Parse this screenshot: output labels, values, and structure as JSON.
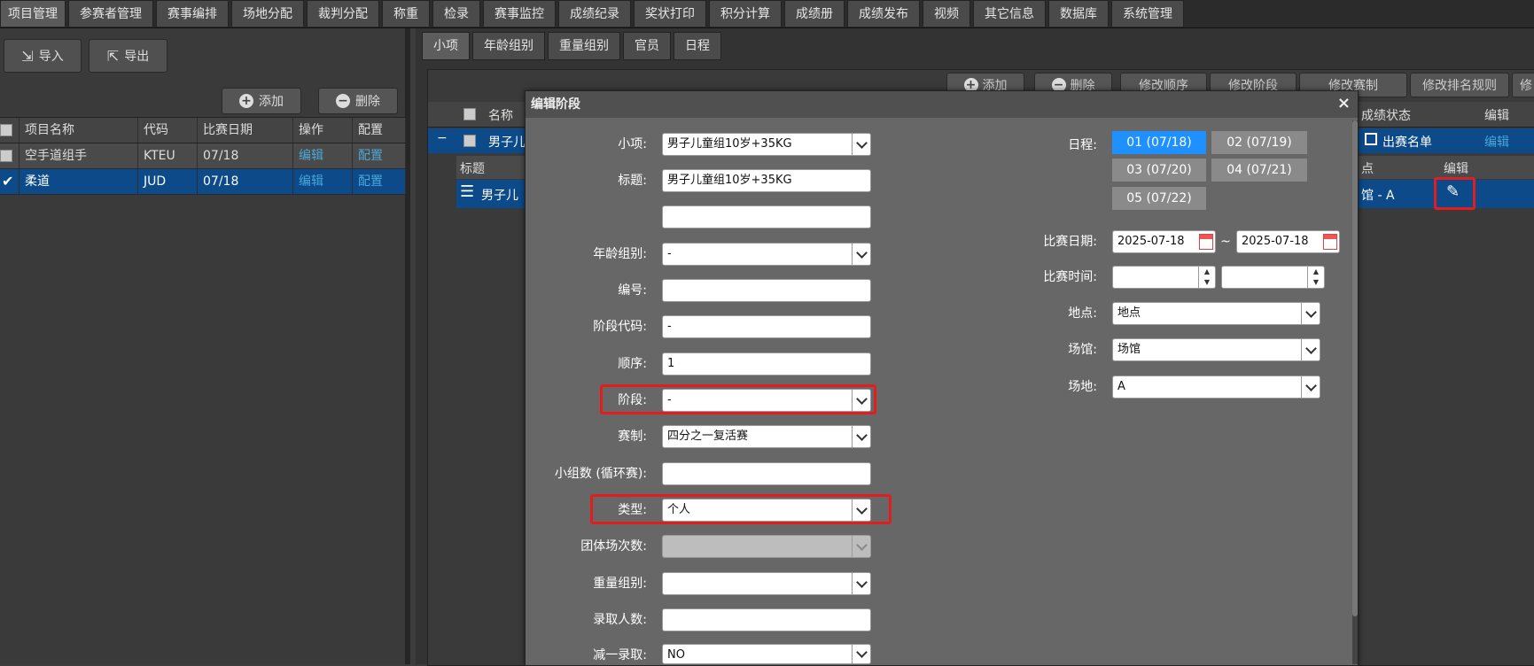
{
  "top_nav": [
    "项目管理",
    "参赛者管理",
    "赛事编排",
    "场地分配",
    "裁判分配",
    "称重",
    "检录",
    "赛事监控",
    "成绩纪录",
    "奖状打印",
    "积分计算",
    "成绩册",
    "成绩发布",
    "视频",
    "其它信息",
    "数据库",
    "系统管理"
  ],
  "left": {
    "import_label": "导入",
    "export_label": "导出",
    "add_label": "添加",
    "delete_label": "删除",
    "columns": [
      "项目名称",
      "代码",
      "比赛日期",
      "操作",
      "配置"
    ],
    "rows": [
      {
        "name": "空手道组手",
        "code": "KTEU",
        "date": "07/18",
        "op": "编辑",
        "cfg": "配置",
        "checked": false,
        "selected": false
      },
      {
        "name": "柔道",
        "code": "JUD",
        "date": "07/18",
        "op": "编辑",
        "cfg": "配置",
        "checked": true,
        "selected": true
      }
    ]
  },
  "right": {
    "subtabs": [
      "小项",
      "年龄组别",
      "重量组别",
      "官员",
      "日程"
    ],
    "toolbar": [
      "添加",
      "删除",
      "修改顺序",
      "修改阶段",
      "修改赛制",
      "修改排名规则",
      "修"
    ],
    "head": {
      "name": "名称",
      "status": "成绩状态",
      "edit": "编辑"
    },
    "row": {
      "minus": "−",
      "name": "男子儿",
      "status": "出赛名单",
      "edit": "编辑"
    },
    "subhead": {
      "title": "标题",
      "point": "点",
      "edit": "编辑"
    },
    "subrow": {
      "name": "男子儿",
      "venue": "馆 - A"
    }
  },
  "modal": {
    "title": "编辑阶段",
    "close": "×",
    "fields": {
      "event": {
        "label": "小项:",
        "value": "男子儿童组10岁+35KG"
      },
      "title": {
        "label": "标题:",
        "value": "男子儿童组10岁+35KG"
      },
      "title2": {
        "value": ""
      },
      "age_group": {
        "label": "年龄组别:",
        "value": "-"
      },
      "number": {
        "label": "编号:",
        "value": ""
      },
      "stage_code": {
        "label": "阶段代码:",
        "value": "-"
      },
      "order": {
        "label": "顺序:",
        "value": "1"
      },
      "stage": {
        "label": "阶段:",
        "value": "-"
      },
      "format": {
        "label": "赛制:",
        "value": "四分之一复活赛"
      },
      "groups": {
        "label": "小组数 (循环赛):",
        "value": ""
      },
      "type": {
        "label": "类型:",
        "value": "个人"
      },
      "team_bouts": {
        "label": "团体场次数:",
        "value": ""
      },
      "weight_group": {
        "label": "重量组别:",
        "value": ""
      },
      "admit": {
        "label": "录取人数:",
        "value": ""
      },
      "minus_one": {
        "label": "减一录取:",
        "value": "NO"
      }
    },
    "schedule": {
      "label": "日程:",
      "days": [
        "01 (07/18)",
        "02 (07/19)",
        "03 (07/20)",
        "04 (07/21)",
        "05 (07/22)"
      ],
      "active": 0
    },
    "match_date": {
      "label": "比赛日期:",
      "from": "2025-07-18",
      "sep": "~",
      "to": "2025-07-18"
    },
    "match_time": {
      "label": "比赛时间:",
      "from": "",
      "to": ""
    },
    "location": {
      "label": "地点:",
      "value": "地点"
    },
    "venue": {
      "label": "场馆:",
      "value": "场馆"
    },
    "court": {
      "label": "场地:",
      "value": "A"
    }
  }
}
